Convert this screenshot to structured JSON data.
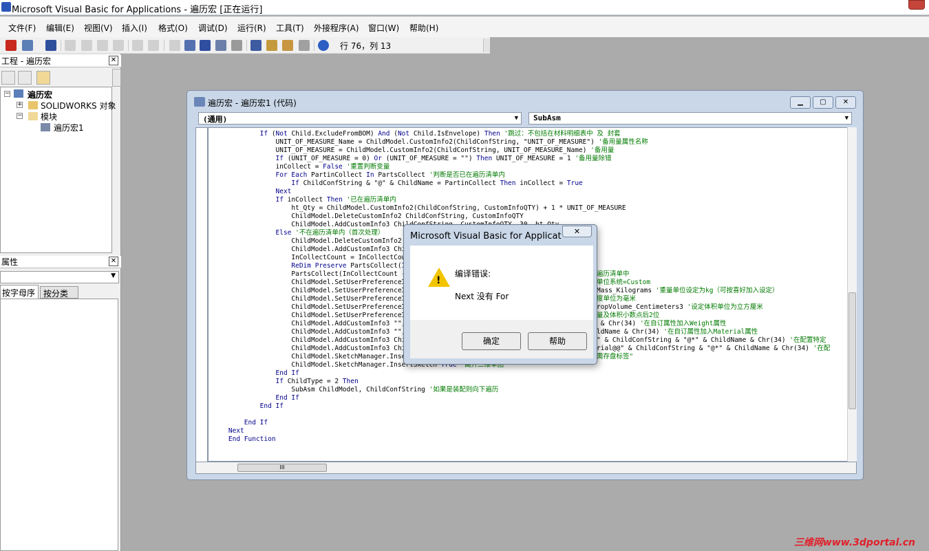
{
  "window": {
    "title": "Microsoft Visual Basic for Applications - 遍历宏 [正在运行]"
  },
  "menubar": {
    "items": [
      "文件(F)",
      "编辑(E)",
      "视图(V)",
      "插入(I)",
      "格式(O)",
      "调试(D)",
      "运行(R)",
      "工具(T)",
      "外接程序(A)",
      "窗口(W)",
      "帮助(H)"
    ]
  },
  "toolbar": {
    "cursor_position": "行 76，列 13"
  },
  "project_panel": {
    "title": "工程 - 遍历宏",
    "root": "遍历宏",
    "nodes": [
      "SOLIDWORKS 对象",
      "模块",
      "遍历宏1"
    ]
  },
  "properties_panel": {
    "title": "属性",
    "tabs": [
      "按字母序",
      "按分类序"
    ]
  },
  "code_window": {
    "title": "遍历宏 - 遍历宏1 (代码)",
    "object_combo": "(通用)",
    "procedure_combo": "SubAsm",
    "lines": [
      {
        "code": "            If (Not Child.ExcludeFromBOM) And (Not Child.IsEnvelope) Then ",
        "comment": "'跳过：不包括在材料明细表中 及 封套"
      },
      {
        "code": "                UNIT_OF_MEASURE_Name = ChildModel.CustomInfo2(ChildConfString, \"UNIT_OF_MEASURE\") ",
        "comment": "'备用量属性名称"
      },
      {
        "code": "                UNIT_OF_MEASURE = ChildModel.CustomInfo2(ChildConfString, UNIT_OF_MEASURE_Name) ",
        "comment": "'备用量"
      },
      {
        "code": "                If (UNIT_OF_MEASURE = 0) Or (UNIT_OF_MEASURE = \"\") Then UNIT_OF_MEASURE = 1 ",
        "comment": "'备用量除错"
      },
      {
        "code": "                inCollect = False ",
        "comment": "'重置判断变量"
      },
      {
        "code": "                For Each PartinCollect In PartsCollect ",
        "comment": "'判断是否已在遍历清单内"
      },
      {
        "code": "                    If ChildConfString & \"@\" & ChildName = PartinCollect Then inCollect = True",
        "comment": ""
      },
      {
        "code": "                Next",
        "comment": ""
      },
      {
        "code": "                If inCollect Then ",
        "comment": "'已在遍历清单内"
      },
      {
        "code": "                    ht_Qty = ChildModel.CustomInfo2(ChildConfString, CustomInfoQTY) + 1 * UNIT_OF_MEASURE",
        "comment": ""
      },
      {
        "code": "                    ChildModel.DeleteCustomInfo2 ChildConfString, CustomInfoQTY",
        "comment": ""
      },
      {
        "code": "                    ChildModel.AddCustomInfo3 ChildConfString, CustomInfoQTY, 30, ht_Qty",
        "comment": ""
      },
      {
        "code": "                Else ",
        "comment": "'不在遍历清单内（首次处理）"
      },
      {
        "code": "                    ChildModel.DeleteCustomInfo2 C",
        "comment": ""
      },
      {
        "code": "                    ChildModel.AddCustomInfo3 Chil",
        "comment": ""
      },
      {
        "code": "                    InCollectCount = InCollectCou",
        "comment": ""
      },
      {
        "code": "                    ReDim Preserve PartsCollect(In",
        "comment": ""
      },
      {
        "code": "                    PartsCollect(InCollectCount - ",
        "comment": ""
      },
      {
        "code": "                    ChildModel.SetUserPreferenceIn",
        "comment": ""
      },
      {
        "code": "                    ChildModel.SetUserPreferenceIn",
        "comment": ""
      },
      {
        "code": "                    ChildModel.SetUserPreferenceIn",
        "comment": ""
      },
      {
        "code": "                    ChildModel.SetUserPreferenceIn",
        "comment": ""
      },
      {
        "code": "                    ChildModel.SetUserPreferenceIn",
        "comment": ""
      },
      {
        "code": "                    ChildModel.AddCustomInfo3 \"\", ",
        "comment": ""
      },
      {
        "code": "                    ChildModel.AddCustomInfo3 \"\", ",
        "comment": ""
      },
      {
        "code": "                    ChildModel.AddCustomInfo3 Chil",
        "comment": ""
      },
      {
        "code": "                    ChildModel.AddCustomInfo3 Chil",
        "comment": ""
      },
      {
        "code": "                    ChildModel.SketchManager.Inser",
        "comment": ""
      },
      {
        "code": "                    ChildModel.SketchManager.InsertSketch True ",
        "comment": "'离开二维草图"
      },
      {
        "code": "                End If",
        "comment": ""
      },
      {
        "code": "                If ChildType = 2 Then",
        "comment": ""
      },
      {
        "code": "                    SubAsm ChildModel, ChildConfString ",
        "comment": "'如果是装配则向下遍历"
      },
      {
        "code": "                End If",
        "comment": ""
      },
      {
        "code": "            End If",
        "comment": ""
      },
      {
        "code": "",
        "comment": ""
      },
      {
        "code": "        End If",
        "comment": ""
      },
      {
        "code": "    Next",
        "comment": ""
      },
      {
        "code": "    End Function",
        "comment": ""
      }
    ],
    "right_fragments": [
      {
        "row": 17,
        "text": "遍历清单中",
        "type": "comment"
      },
      {
        "row": 18,
        "text": "单位系统=Custom",
        "type": "comment"
      },
      {
        "row": 19,
        "text": "Mass_Kilograms ",
        "type": "code",
        "more": "'重量单位设定为kg（可按喜好加入设定）"
      },
      {
        "row": 20,
        "text": "度单位为毫米",
        "type": "comment"
      },
      {
        "row": 21,
        "text": "ropVolume_Centimeters3 ",
        "type": "code",
        "more": "'设定体积单位为立方厘米"
      },
      {
        "row": 22,
        "text": "量及体积小数点后2位",
        "type": "comment"
      },
      {
        "row": 23,
        "text": " & Chr(34) ",
        "type": "code",
        "more": "'在自订属性加入Weight属性"
      },
      {
        "row": 24,
        "text": "ldName & Chr(34) ",
        "type": "code",
        "more": "'在自订属性加入Material属性"
      },
      {
        "row": 25,
        "text": "\" & ChildConfString & \"@*\" & ChildName & Chr(34) ",
        "type": "code",
        "more": "'在配置特定"
      },
      {
        "row": 26,
        "text": "rial@@\" & ChildConfString & \"@*\" & ChildName & Chr(34) ",
        "type": "code",
        "more": "'在配"
      },
      {
        "row": 27,
        "text": "需存盘标签\"",
        "type": "comment"
      }
    ],
    "hscroll_thumb": "III"
  },
  "dialog": {
    "title": "Microsoft Visual Basic for Applicatio...",
    "heading": "编译错误:",
    "message": "Next 没有 For",
    "ok_label": "确定",
    "help_label": "帮助"
  },
  "watermark": "三维网www.3dportal.cn"
}
